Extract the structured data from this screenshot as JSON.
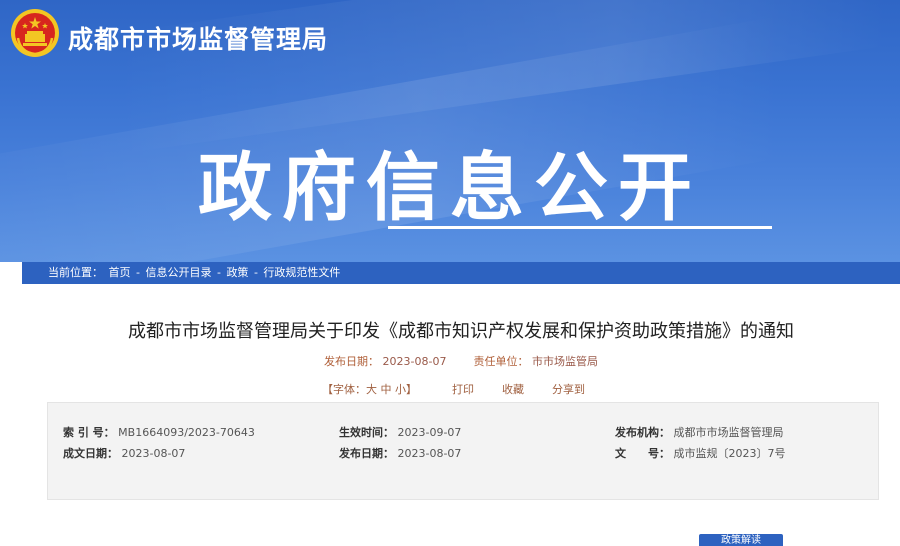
{
  "site": {
    "title": "成都市市场监督管理局"
  },
  "banner": {
    "headline": "政府信息公开"
  },
  "breadcrumb": {
    "prefix": "当前位置：",
    "items": [
      "首页",
      "信息公开目录",
      "政策",
      "行政规范性文件"
    ],
    "sep": " - "
  },
  "article": {
    "title": "成都市市场监督管理局关于印发《成都市知识产权发展和保护资助政策措施》的通知",
    "publish_label": "发布日期：",
    "publish_date": "2023-08-07",
    "unit_label": "责任单位：",
    "unit": "市市场监管局"
  },
  "tools": {
    "fontsize": "【字体：大 中 小】",
    "print": "打印",
    "favorite": "收藏",
    "share": "分享到"
  },
  "info": {
    "index_label": "索 引 号：",
    "index_value": "MB1664093/2023-70643",
    "effective_label": "生效时间：",
    "effective_value": "2023-09-07",
    "org_label": "发布机构：",
    "org_value": "成都市市场监督管理局",
    "created_label": "成文日期：",
    "created_value": "2023-08-07",
    "publish_label": "发布日期：",
    "publish_value": "2023-08-07",
    "docno_label": "文　　号：",
    "docno_value": "成市监规〔2023〕7号"
  },
  "corner_button": "政策解读",
  "colors": {
    "banner": "#3a73d2",
    "bar": "#2d62c0",
    "emblem_red": "#d7261e",
    "emblem_gold": "#f3c623"
  }
}
